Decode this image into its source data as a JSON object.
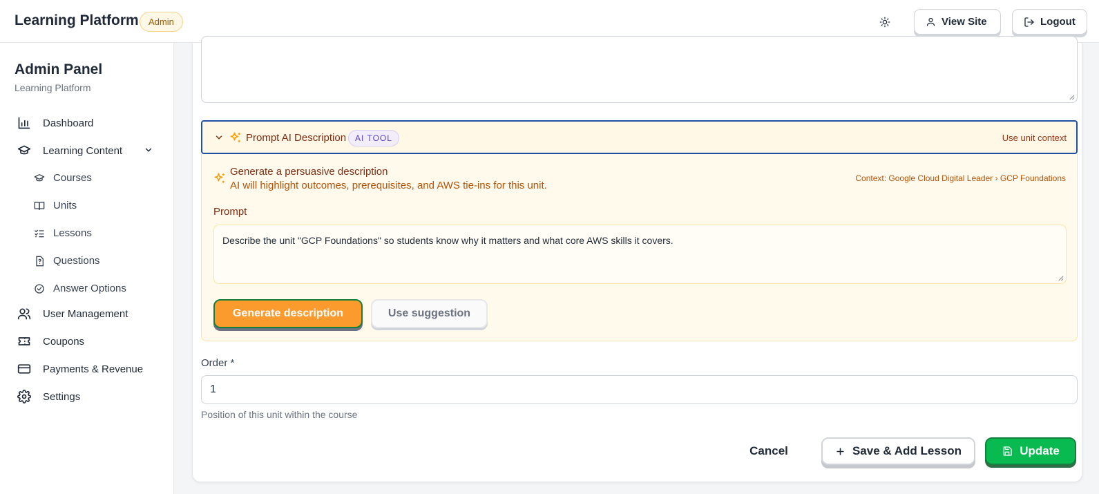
{
  "header": {
    "brand": "Learning Platform",
    "badge": "Admin",
    "theme_icon": "sun-icon",
    "view_site": "View Site",
    "logout": "Logout"
  },
  "sidebar": {
    "title": "Admin Panel",
    "subtitle": "Learning Platform",
    "items": [
      {
        "label": "Dashboard",
        "icon": "bar-chart-icon"
      },
      {
        "label": "Learning Content",
        "icon": "graduation-cap-icon",
        "expanded": true
      },
      {
        "label": "Courses",
        "icon": "graduation-cap-icon"
      },
      {
        "label": "Units",
        "icon": "book-open-icon"
      },
      {
        "label": "Lessons",
        "icon": "list-checks-icon"
      },
      {
        "label": "Questions",
        "icon": "file-question-icon"
      },
      {
        "label": "Answer Options",
        "icon": "check-circle-icon"
      },
      {
        "label": "User Management",
        "icon": "users-icon"
      },
      {
        "label": "Coupons",
        "icon": "ticket-icon"
      },
      {
        "label": "Payments & Revenue",
        "icon": "credit-card-icon"
      },
      {
        "label": "Settings",
        "icon": "gear-icon"
      }
    ]
  },
  "form": {
    "description_partial": "",
    "ai": {
      "title": "Prompt AI Description",
      "tag": "AI TOOL",
      "use_context": "Use unit context",
      "gen_title": "Generate a persuasive description",
      "gen_desc": "AI will highlight outcomes, prerequisites, and AWS tie-ins for this unit.",
      "context": "Context: Google Cloud Digital Leader › GCP Foundations",
      "prompt_label": "Prompt",
      "prompt_value": "Describe the unit \"GCP Foundations\" so students know why it matters and what core AWS skills it covers.",
      "generate_btn": "Generate description",
      "suggestion_btn": "Use suggestion"
    },
    "order_label": "Order *",
    "order_value": "1",
    "order_help": "Position of this unit within the course"
  },
  "actions": {
    "cancel": "Cancel",
    "save_add": "Save & Add Lesson",
    "update": "Update"
  },
  "colors": {
    "accent_blue": "#1e4fa3",
    "ai_bg": "#fff8e6",
    "generate_orange": "#fb9a2d",
    "update_green": "#09ba51"
  }
}
